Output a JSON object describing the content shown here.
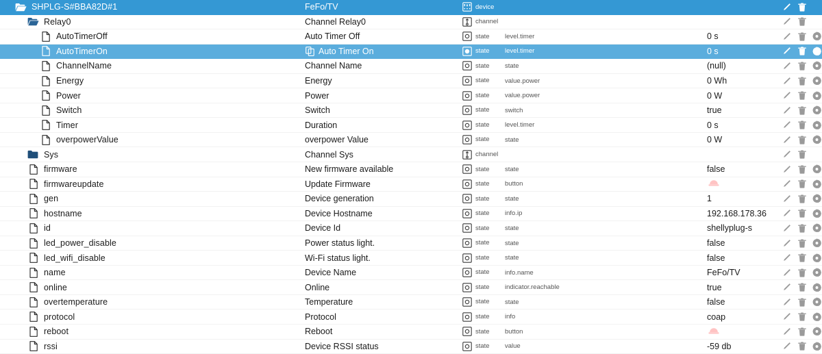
{
  "colors": {
    "header_blue": "#3498d4",
    "selected_blue": "#5baddd",
    "folder_open": "#2a6496",
    "folder_closed": "#1f4e79",
    "button_pink": "#ffc3c3",
    "action_icon": "#9a9a9a",
    "text": "#1a1a1a",
    "muted_text": "#555555"
  },
  "icons": {
    "folder_open": "folder-open-icon",
    "folder_closed": "folder-closed-icon",
    "file": "file-icon",
    "copy": "copy-icon",
    "device": "device-icon",
    "channel": "channel-icon",
    "state": "state-icon",
    "state_selected": "state-selected-icon",
    "edit": "pencil-icon",
    "delete": "trash-icon",
    "settings": "gear-icon",
    "button_value": "push-button-icon"
  },
  "rows": [
    {
      "name": "SHPLG-S#BBA82D#1",
      "indent": 0,
      "icon": "folder-open",
      "desc": "FeFo/TV",
      "copy": false,
      "type": "device",
      "type_icon": "device",
      "role": "",
      "value": "",
      "value_kind": "text",
      "state": "header",
      "actions": [
        "edit",
        "delete"
      ]
    },
    {
      "name": "Relay0",
      "indent": 1,
      "icon": "folder-open",
      "desc": "Channel Relay0",
      "copy": false,
      "type": "channel",
      "type_icon": "channel",
      "role": "",
      "value": "",
      "value_kind": "text",
      "state": "normal",
      "actions": [
        "edit",
        "delete"
      ]
    },
    {
      "name": "AutoTimerOff",
      "indent": 2,
      "icon": "file",
      "desc": "Auto Timer Off",
      "copy": false,
      "type": "state",
      "type_icon": "state",
      "role": "level.timer",
      "value": "0 s",
      "value_kind": "text",
      "state": "normal",
      "actions": [
        "edit",
        "delete",
        "settings"
      ]
    },
    {
      "name": "AutoTimerOn",
      "indent": 2,
      "icon": "file",
      "desc": "Auto Timer On",
      "copy": true,
      "type": "state",
      "type_icon": "state-selected",
      "role": "level.timer",
      "value": "0 s",
      "value_kind": "text",
      "state": "selected",
      "actions": [
        "edit",
        "delete",
        "settings"
      ]
    },
    {
      "name": "ChannelName",
      "indent": 2,
      "icon": "file",
      "desc": "Channel Name",
      "copy": false,
      "type": "state",
      "type_icon": "state",
      "role": "state",
      "value": "(null)",
      "value_kind": "text",
      "state": "normal",
      "actions": [
        "edit",
        "delete",
        "settings"
      ]
    },
    {
      "name": "Energy",
      "indent": 2,
      "icon": "file",
      "desc": "Energy",
      "copy": false,
      "type": "state",
      "type_icon": "state",
      "role": "value.power",
      "value": "0 Wh",
      "value_kind": "text",
      "state": "normal",
      "actions": [
        "edit",
        "delete",
        "settings"
      ]
    },
    {
      "name": "Power",
      "indent": 2,
      "icon": "file",
      "desc": "Power",
      "copy": false,
      "type": "state",
      "type_icon": "state",
      "role": "value.power",
      "value": "0 W",
      "value_kind": "text",
      "state": "normal",
      "actions": [
        "edit",
        "delete",
        "settings"
      ]
    },
    {
      "name": "Switch",
      "indent": 2,
      "icon": "file",
      "desc": "Switch",
      "copy": false,
      "type": "state",
      "type_icon": "state",
      "role": "switch",
      "value": "true",
      "value_kind": "text",
      "state": "normal",
      "actions": [
        "edit",
        "delete",
        "settings"
      ]
    },
    {
      "name": "Timer",
      "indent": 2,
      "icon": "file",
      "desc": "Duration",
      "copy": false,
      "type": "state",
      "type_icon": "state",
      "role": "level.timer",
      "value": "0 s",
      "value_kind": "text",
      "state": "normal",
      "actions": [
        "edit",
        "delete",
        "settings"
      ]
    },
    {
      "name": "overpowerValue",
      "indent": 2,
      "icon": "file",
      "desc": "overpower Value",
      "copy": false,
      "type": "state",
      "type_icon": "state",
      "role": "state",
      "value": "0 W",
      "value_kind": "text",
      "state": "normal",
      "actions": [
        "edit",
        "delete",
        "settings"
      ]
    },
    {
      "name": "Sys",
      "indent": 1,
      "icon": "folder-closed",
      "desc": "Channel Sys",
      "copy": false,
      "type": "channel",
      "type_icon": "channel",
      "role": "",
      "value": "",
      "value_kind": "text",
      "state": "normal",
      "actions": [
        "edit",
        "delete"
      ]
    },
    {
      "name": "firmware",
      "indent": 1,
      "icon": "file",
      "desc": "New firmware available",
      "copy": false,
      "type": "state",
      "type_icon": "state",
      "role": "state",
      "value": "false",
      "value_kind": "text",
      "state": "normal",
      "actions": [
        "edit",
        "delete",
        "settings"
      ]
    },
    {
      "name": "firmwareupdate",
      "indent": 1,
      "icon": "file",
      "desc": "Update Firmware",
      "copy": false,
      "type": "state",
      "type_icon": "state",
      "role": "button",
      "value": "",
      "value_kind": "button",
      "state": "normal",
      "actions": [
        "edit",
        "delete",
        "settings"
      ]
    },
    {
      "name": "gen",
      "indent": 1,
      "icon": "file",
      "desc": "Device generation",
      "copy": false,
      "type": "state",
      "type_icon": "state",
      "role": "state",
      "value": "1",
      "value_kind": "text",
      "state": "normal",
      "actions": [
        "edit",
        "delete",
        "settings"
      ]
    },
    {
      "name": "hostname",
      "indent": 1,
      "icon": "file",
      "desc": "Device Hostname",
      "copy": false,
      "type": "state",
      "type_icon": "state",
      "role": "info.ip",
      "value": "192.168.178.36",
      "value_kind": "text",
      "state": "normal",
      "actions": [
        "edit",
        "delete",
        "settings"
      ]
    },
    {
      "name": "id",
      "indent": 1,
      "icon": "file",
      "desc": "Device Id",
      "copy": false,
      "type": "state",
      "type_icon": "state",
      "role": "state",
      "value": "shellyplug-s",
      "value_kind": "text",
      "state": "normal",
      "actions": [
        "edit",
        "delete",
        "settings"
      ]
    },
    {
      "name": "led_power_disable",
      "indent": 1,
      "icon": "file",
      "desc": "Power status light.",
      "copy": false,
      "type": "state",
      "type_icon": "state",
      "role": "state",
      "value": "false",
      "value_kind": "text",
      "state": "normal",
      "actions": [
        "edit",
        "delete",
        "settings"
      ]
    },
    {
      "name": "led_wifi_disable",
      "indent": 1,
      "icon": "file",
      "desc": "Wi-Fi status light.",
      "copy": false,
      "type": "state",
      "type_icon": "state",
      "role": "state",
      "value": "false",
      "value_kind": "text",
      "state": "normal",
      "actions": [
        "edit",
        "delete",
        "settings"
      ]
    },
    {
      "name": "name",
      "indent": 1,
      "icon": "file",
      "desc": "Device Name",
      "copy": false,
      "type": "state",
      "type_icon": "state",
      "role": "info.name",
      "value": "FeFo/TV",
      "value_kind": "text",
      "state": "normal",
      "actions": [
        "edit",
        "delete",
        "settings"
      ]
    },
    {
      "name": "online",
      "indent": 1,
      "icon": "file",
      "desc": "Online",
      "copy": false,
      "type": "state",
      "type_icon": "state",
      "role": "indicator.reachable",
      "value": "true",
      "value_kind": "text",
      "state": "normal",
      "actions": [
        "edit",
        "delete",
        "settings"
      ]
    },
    {
      "name": "overtemperature",
      "indent": 1,
      "icon": "file",
      "desc": "Temperature",
      "copy": false,
      "type": "state",
      "type_icon": "state",
      "role": "state",
      "value": "false",
      "value_kind": "text",
      "state": "normal",
      "actions": [
        "edit",
        "delete",
        "settings"
      ]
    },
    {
      "name": "protocol",
      "indent": 1,
      "icon": "file",
      "desc": "Protocol",
      "copy": false,
      "type": "state",
      "type_icon": "state",
      "role": "info",
      "value": "coap",
      "value_kind": "text",
      "state": "normal",
      "actions": [
        "edit",
        "delete",
        "settings"
      ]
    },
    {
      "name": "reboot",
      "indent": 1,
      "icon": "file",
      "desc": "Reboot",
      "copy": false,
      "type": "state",
      "type_icon": "state",
      "role": "button",
      "value": "",
      "value_kind": "button",
      "state": "normal",
      "actions": [
        "edit",
        "delete",
        "settings"
      ]
    },
    {
      "name": "rssi",
      "indent": 1,
      "icon": "file",
      "desc": "Device RSSI status",
      "copy": false,
      "type": "state",
      "type_icon": "state",
      "role": "value",
      "value": "-59 db",
      "value_kind": "text",
      "state": "normal",
      "actions": [
        "edit",
        "delete",
        "settings"
      ]
    }
  ]
}
